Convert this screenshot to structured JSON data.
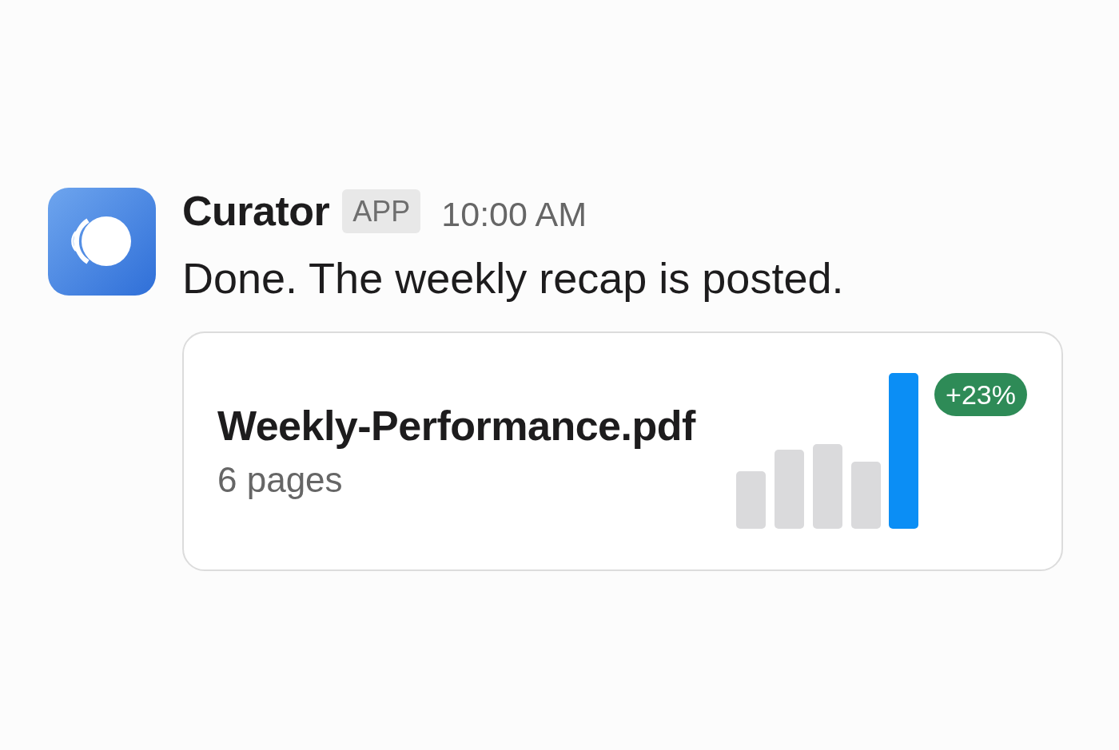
{
  "message": {
    "sender": "Curator",
    "sender_badge": "APP",
    "time": "10:00 AM",
    "text": "Done. The weekly recap is posted.",
    "attachment": {
      "file_name": "Weekly-Performance.pdf",
      "meta": "6 pages",
      "change_badge": "+23%"
    }
  }
}
